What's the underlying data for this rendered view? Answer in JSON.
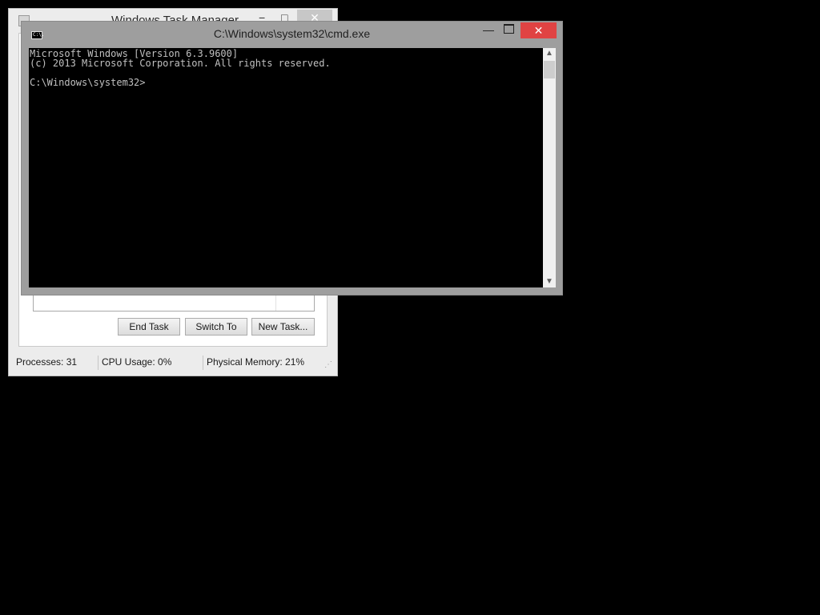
{
  "task_manager": {
    "title": "Windows Task Manager",
    "controls": {
      "minimize": "−",
      "maximize": "□",
      "close": "✕"
    },
    "buttons": {
      "end_task": "End Task",
      "switch_to": "Switch To",
      "new_task": "New Task..."
    },
    "status": {
      "processes": "Processes: 31",
      "cpu": "CPU Usage: 0%",
      "memory": "Physical Memory: 21%"
    }
  },
  "cmd": {
    "title": "C:\\Windows\\system32\\cmd.exe",
    "icon_label": "C:\\.",
    "controls": {
      "minimize": "—",
      "close": "✕"
    },
    "lines": [
      "Microsoft Windows [Version 6.3.9600]",
      "(c) 2013 Microsoft Corporation. All rights reserved.",
      "",
      "C:\\Windows\\system32>"
    ],
    "scroll_up": "▲",
    "scroll_down": "▼"
  }
}
